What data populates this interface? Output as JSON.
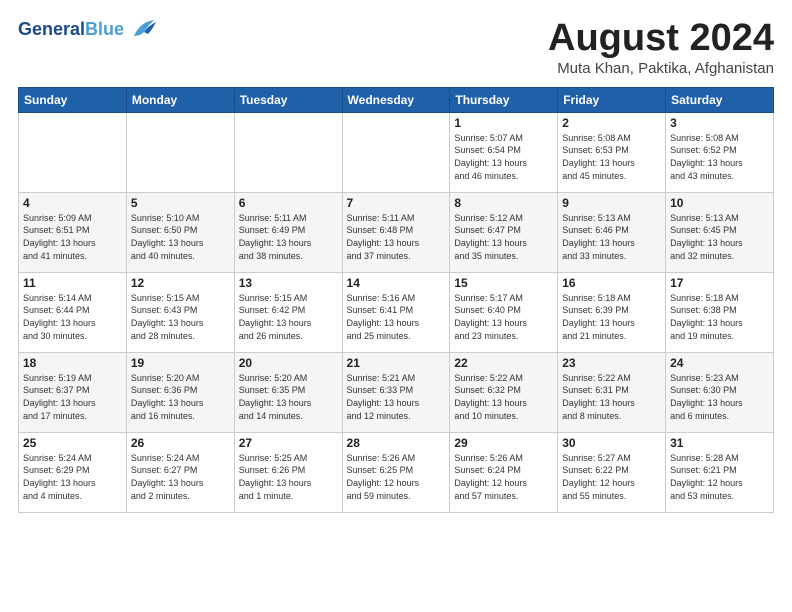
{
  "header": {
    "logo_line1": "General",
    "logo_line2": "Blue",
    "month_title": "August 2024",
    "location": "Muta Khan, Paktika, Afghanistan"
  },
  "weekdays": [
    "Sunday",
    "Monday",
    "Tuesday",
    "Wednesday",
    "Thursday",
    "Friday",
    "Saturday"
  ],
  "weeks": [
    [
      {
        "day": "",
        "info": ""
      },
      {
        "day": "",
        "info": ""
      },
      {
        "day": "",
        "info": ""
      },
      {
        "day": "",
        "info": ""
      },
      {
        "day": "1",
        "info": "Sunrise: 5:07 AM\nSunset: 6:54 PM\nDaylight: 13 hours\nand 46 minutes."
      },
      {
        "day": "2",
        "info": "Sunrise: 5:08 AM\nSunset: 6:53 PM\nDaylight: 13 hours\nand 45 minutes."
      },
      {
        "day": "3",
        "info": "Sunrise: 5:08 AM\nSunset: 6:52 PM\nDaylight: 13 hours\nand 43 minutes."
      }
    ],
    [
      {
        "day": "4",
        "info": "Sunrise: 5:09 AM\nSunset: 6:51 PM\nDaylight: 13 hours\nand 41 minutes."
      },
      {
        "day": "5",
        "info": "Sunrise: 5:10 AM\nSunset: 6:50 PM\nDaylight: 13 hours\nand 40 minutes."
      },
      {
        "day": "6",
        "info": "Sunrise: 5:11 AM\nSunset: 6:49 PM\nDaylight: 13 hours\nand 38 minutes."
      },
      {
        "day": "7",
        "info": "Sunrise: 5:11 AM\nSunset: 6:48 PM\nDaylight: 13 hours\nand 37 minutes."
      },
      {
        "day": "8",
        "info": "Sunrise: 5:12 AM\nSunset: 6:47 PM\nDaylight: 13 hours\nand 35 minutes."
      },
      {
        "day": "9",
        "info": "Sunrise: 5:13 AM\nSunset: 6:46 PM\nDaylight: 13 hours\nand 33 minutes."
      },
      {
        "day": "10",
        "info": "Sunrise: 5:13 AM\nSunset: 6:45 PM\nDaylight: 13 hours\nand 32 minutes."
      }
    ],
    [
      {
        "day": "11",
        "info": "Sunrise: 5:14 AM\nSunset: 6:44 PM\nDaylight: 13 hours\nand 30 minutes."
      },
      {
        "day": "12",
        "info": "Sunrise: 5:15 AM\nSunset: 6:43 PM\nDaylight: 13 hours\nand 28 minutes."
      },
      {
        "day": "13",
        "info": "Sunrise: 5:15 AM\nSunset: 6:42 PM\nDaylight: 13 hours\nand 26 minutes."
      },
      {
        "day": "14",
        "info": "Sunrise: 5:16 AM\nSunset: 6:41 PM\nDaylight: 13 hours\nand 25 minutes."
      },
      {
        "day": "15",
        "info": "Sunrise: 5:17 AM\nSunset: 6:40 PM\nDaylight: 13 hours\nand 23 minutes."
      },
      {
        "day": "16",
        "info": "Sunrise: 5:18 AM\nSunset: 6:39 PM\nDaylight: 13 hours\nand 21 minutes."
      },
      {
        "day": "17",
        "info": "Sunrise: 5:18 AM\nSunset: 6:38 PM\nDaylight: 13 hours\nand 19 minutes."
      }
    ],
    [
      {
        "day": "18",
        "info": "Sunrise: 5:19 AM\nSunset: 6:37 PM\nDaylight: 13 hours\nand 17 minutes."
      },
      {
        "day": "19",
        "info": "Sunrise: 5:20 AM\nSunset: 6:36 PM\nDaylight: 13 hours\nand 16 minutes."
      },
      {
        "day": "20",
        "info": "Sunrise: 5:20 AM\nSunset: 6:35 PM\nDaylight: 13 hours\nand 14 minutes."
      },
      {
        "day": "21",
        "info": "Sunrise: 5:21 AM\nSunset: 6:33 PM\nDaylight: 13 hours\nand 12 minutes."
      },
      {
        "day": "22",
        "info": "Sunrise: 5:22 AM\nSunset: 6:32 PM\nDaylight: 13 hours\nand 10 minutes."
      },
      {
        "day": "23",
        "info": "Sunrise: 5:22 AM\nSunset: 6:31 PM\nDaylight: 13 hours\nand 8 minutes."
      },
      {
        "day": "24",
        "info": "Sunrise: 5:23 AM\nSunset: 6:30 PM\nDaylight: 13 hours\nand 6 minutes."
      }
    ],
    [
      {
        "day": "25",
        "info": "Sunrise: 5:24 AM\nSunset: 6:29 PM\nDaylight: 13 hours\nand 4 minutes."
      },
      {
        "day": "26",
        "info": "Sunrise: 5:24 AM\nSunset: 6:27 PM\nDaylight: 13 hours\nand 2 minutes."
      },
      {
        "day": "27",
        "info": "Sunrise: 5:25 AM\nSunset: 6:26 PM\nDaylight: 13 hours\nand 1 minute."
      },
      {
        "day": "28",
        "info": "Sunrise: 5:26 AM\nSunset: 6:25 PM\nDaylight: 12 hours\nand 59 minutes."
      },
      {
        "day": "29",
        "info": "Sunrise: 5:26 AM\nSunset: 6:24 PM\nDaylight: 12 hours\nand 57 minutes."
      },
      {
        "day": "30",
        "info": "Sunrise: 5:27 AM\nSunset: 6:22 PM\nDaylight: 12 hours\nand 55 minutes."
      },
      {
        "day": "31",
        "info": "Sunrise: 5:28 AM\nSunset: 6:21 PM\nDaylight: 12 hours\nand 53 minutes."
      }
    ]
  ]
}
